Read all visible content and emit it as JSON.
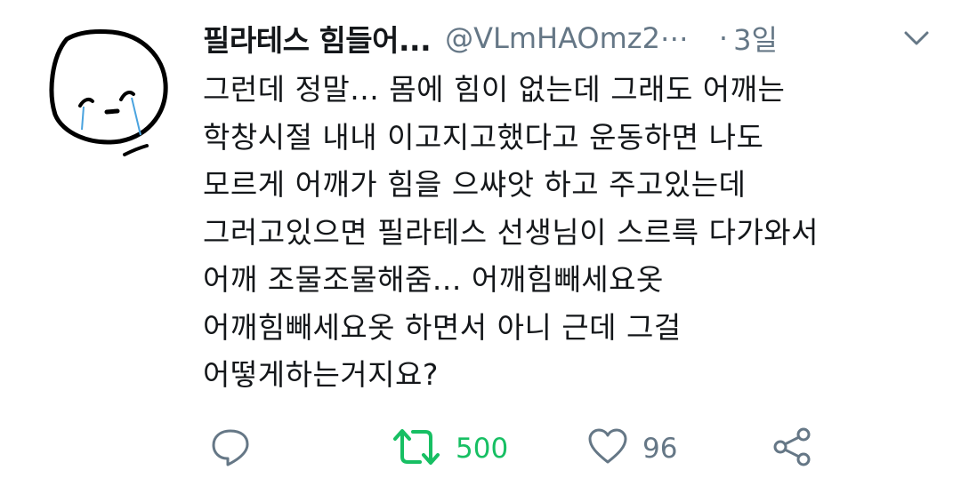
{
  "tweet": {
    "display_name": "필라테스 힘들어...",
    "handle": "@VLmHAOmz2⋯",
    "separator": "·",
    "time": "3일",
    "text": "그런데 정말... 몸에 힘이 없는데 그래도 어깨는\n학창시절 내내 이고지고했다고 운동하면 나도\n모르게 어깨가 힘을 으쌰앗 하고 주고있는데\n그러고있으면 필라테스 선생님이 스르륵 다가와서\n어깨 조물조물해줌... 어깨힘빼세요옷\n어깨힘빼세요옷 하면서 아니 근데 그걸\n어떻게하는거지요?"
  },
  "actions": {
    "reply_icon": "reply-icon",
    "retweet_icon": "retweet-icon",
    "retweet_count": "500",
    "like_icon": "heart-icon",
    "like_count": "96",
    "share_icon": "share-icon"
  },
  "colors": {
    "text": "#14171a",
    "secondary": "#657786",
    "retweet_active": "#17bf63",
    "avatar_tear": "#4aa3df"
  }
}
